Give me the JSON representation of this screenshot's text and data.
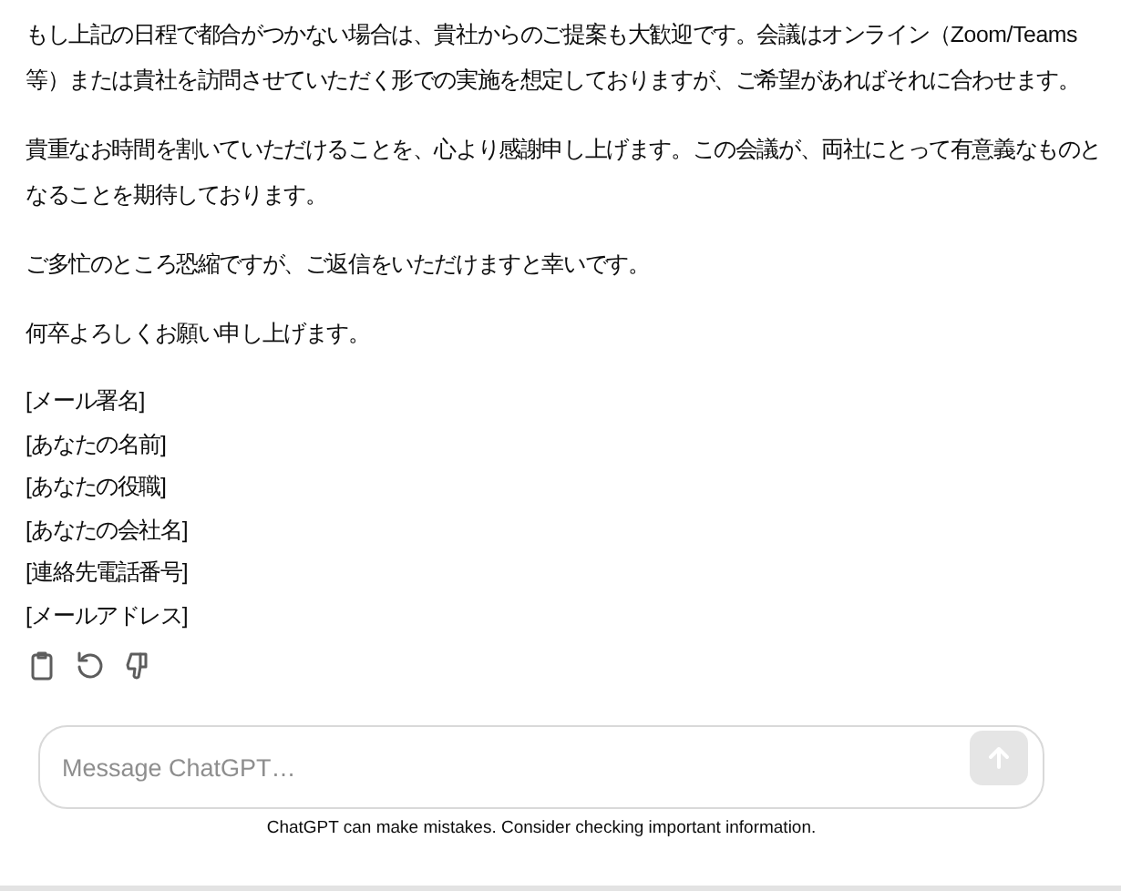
{
  "message": {
    "paragraphs": [
      "もし上記の日程で都合がつかない場合は、貴社からのご提案も大歓迎です。会議はオンライン（Zoom/Teams等）または貴社を訪問させていただく形での実施を想定しておりますが、ご希望があればそれに合わせます。",
      "貴重なお時間を割いていただけることを、心より感謝申し上げます。この会議が、両社にとって有意義なものとなることを期待しております。",
      "ご多忙のところ恐縮ですが、ご返信をいただけますと幸いです。",
      "何卒よろしくお願い申し上げます。"
    ],
    "signature": [
      "[メール署名]",
      "[あなたの名前]",
      "[あなたの役職]",
      "[あなたの会社名]",
      "[連絡先電話番号]",
      "[メールアドレス]"
    ],
    "actions": [
      {
        "kind": "copy"
      },
      {
        "kind": "regenerate"
      },
      {
        "kind": "dislike"
      }
    ]
  },
  "composer": {
    "placeholder": "Message ChatGPT…",
    "send_disabled": true
  },
  "footer": "ChatGPT can make mistakes. Consider checking important information."
}
